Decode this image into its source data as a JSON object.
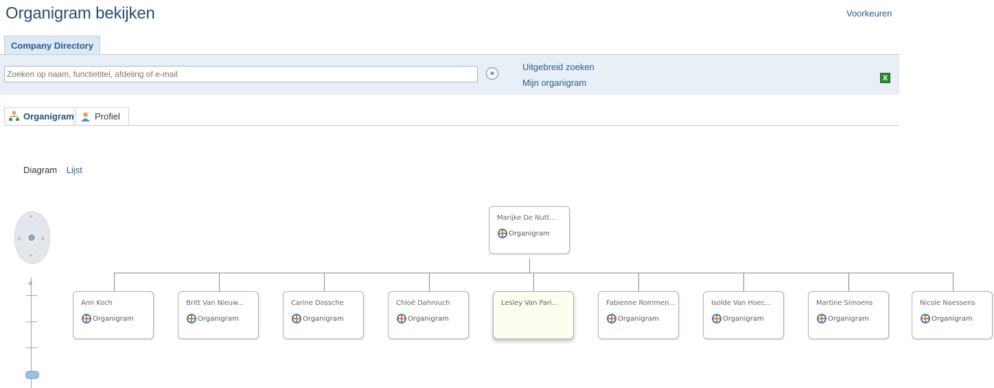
{
  "header": {
    "title": "Organigram bekijken",
    "preferences_link": "Voorkeuren"
  },
  "directory_tab": {
    "label": "Company Directory"
  },
  "search": {
    "placeholder": "Zoeken op naam, functietitel, afdeling of e-mail",
    "go_label": "»",
    "advanced_link": "Uitgebreid zoeken",
    "my_org_link": "Mijn organigram",
    "export_icon": "excel-icon",
    "export_label": "X"
  },
  "view_tabs": [
    {
      "label": "Organigram",
      "icon": "org-chart-icon",
      "active": true
    },
    {
      "label": "Profiel",
      "icon": "profile-icon",
      "active": false
    }
  ],
  "modes": {
    "diagram": "Diagram",
    "list": "Lijst"
  },
  "navigation": {
    "up": "⌃",
    "down": "⌄",
    "left": "‹",
    "right": "›",
    "zoom_in": "+"
  },
  "org_chart": {
    "link_label": "Organigram",
    "root": {
      "name": "Marijke De Nutt..."
    },
    "children": [
      {
        "name": "Ann Koch",
        "has_link": true,
        "selected": false
      },
      {
        "name": "Britt Van Nieuw...",
        "has_link": true,
        "selected": false
      },
      {
        "name": "Carine Dossche",
        "has_link": true,
        "selected": false
      },
      {
        "name": "Chloë Dahrouch",
        "has_link": true,
        "selected": false
      },
      {
        "name": "Lesley Van Pari...",
        "has_link": false,
        "selected": true
      },
      {
        "name": "Fabienne Rommen...",
        "has_link": true,
        "selected": false
      },
      {
        "name": "Isolde Van Hoec...",
        "has_link": true,
        "selected": false
      },
      {
        "name": "Martine Simoens",
        "has_link": true,
        "selected": false
      },
      {
        "name": "Nicole Naessens",
        "has_link": true,
        "selected": false
      }
    ]
  }
}
